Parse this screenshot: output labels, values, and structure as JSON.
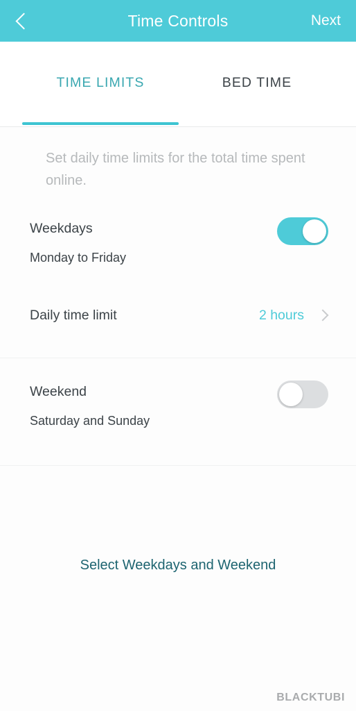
{
  "header": {
    "title": "Time Controls",
    "back_icon": "chevron-left-icon",
    "next_label": "Next"
  },
  "tabs": [
    {
      "label": "TIME LIMITS",
      "active": true
    },
    {
      "label": "BED TIME",
      "active": false
    }
  ],
  "content": {
    "intro": "Set daily time limits for the total time spent online.",
    "rows": [
      {
        "label": "Weekdays",
        "sublabel": "Monday to Friday",
        "toggle_state": "on"
      },
      {
        "label": "Daily time limit",
        "value": "2 hours",
        "chevron_icon": "chevron-right-icon"
      },
      {
        "label": "Weekend",
        "sublabel": "Saturday and Sunday",
        "toggle_state": "off"
      }
    ],
    "link_label": "Select Weekdays and Weekend"
  },
  "watermark": "BLACKTUBI",
  "colors": {
    "accent": "#4ecbd8",
    "accent_dark": "#39a7b0",
    "link": "#1d6470",
    "text": "#3c4348",
    "muted": "#b6b9bb",
    "toggle_off": "#dcdee0"
  }
}
